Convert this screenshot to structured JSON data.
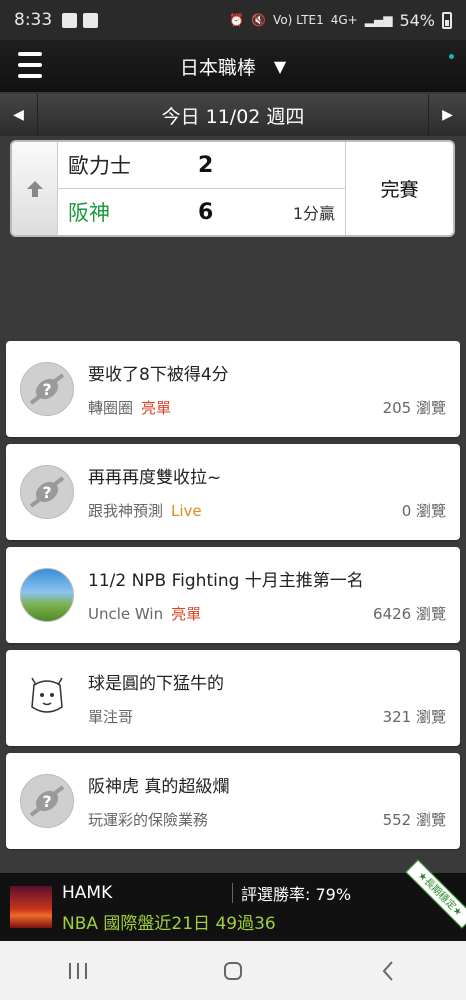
{
  "status_bar": {
    "time": "8:33",
    "battery": "54%",
    "network": "4G+",
    "volte": "Vo) LTE1"
  },
  "nav": {
    "league": "日本職棒",
    "caret": "▼"
  },
  "datebar": {
    "prev": "◀",
    "date": "今日 11/02 週四",
    "next": "▶"
  },
  "game": {
    "away_team": "歐力士",
    "away_score": "2",
    "home_team": "阪神",
    "home_score": "6",
    "margin": "1分贏",
    "status": "完賽",
    "home_color": "#1a9a3a"
  },
  "posts": [
    {
      "title": "要收了8下被得4分",
      "author": "轉圈圈",
      "tag": "亮單",
      "tag_type": "hot",
      "views": "205 瀏覽",
      "avatar": "default"
    },
    {
      "title": "再再再度雙收拉~",
      "author": "跟我神預測",
      "tag": "Live",
      "tag_type": "live",
      "views": "0 瀏覽",
      "avatar": "default"
    },
    {
      "title": "11/2 NPB Fighting 十月主推第一名",
      "author": "Uncle Win",
      "tag": "亮單",
      "tag_type": "hot",
      "views": "6426 瀏覽",
      "avatar": "photo"
    },
    {
      "title": "球是圓的下猛牛的",
      "author": "單注哥",
      "tag": "",
      "tag_type": "none",
      "views": "321 瀏覽",
      "avatar": "cartoon"
    },
    {
      "title": "阪神虎 真的超級爛",
      "author": "玩運彩的保險業務",
      "tag": "",
      "tag_type": "none",
      "views": "552 瀏覽",
      "avatar": "default"
    }
  ],
  "banner": {
    "name": "HAMK",
    "rate": "評選勝率: 79%",
    "record": "NBA 國際盤近21日 49過36",
    "ribbon": "★長期穩定★"
  },
  "colors": {
    "hot": "#d9462a",
    "live": "#e08a18",
    "banner_green": "#9ed13a"
  }
}
